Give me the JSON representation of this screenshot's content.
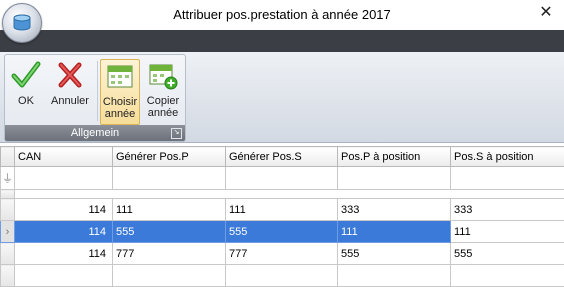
{
  "window": {
    "title": "Attribuer pos.prestation à année 2017",
    "close_glyph": "✕"
  },
  "ribbon": {
    "group_label": "Allgemein",
    "buttons": {
      "ok": "OK",
      "annuler": "Annuler",
      "choisir": "Choisir année",
      "copier": "Copier année"
    },
    "icons": [
      "check-icon",
      "x-icon",
      "calendar-icon",
      "calendar-add-icon"
    ]
  },
  "grid": {
    "columns": [
      "CAN",
      "Générer Pos.P",
      "Générer Pos.S",
      "Pos.P à position",
      "Pos.S à position"
    ],
    "rows": [
      {
        "can": "114",
        "gen_p": "111",
        "gen_s": "111",
        "pos_p": "333",
        "pos_s": "333"
      },
      {
        "can": "114",
        "gen_p": "555",
        "gen_s": "555",
        "pos_p": "111",
        "pos_s": "111"
      },
      {
        "can": "114",
        "gen_p": "777",
        "gen_s": "777",
        "pos_p": "555",
        "pos_s": "555"
      }
    ],
    "selected_row_index": 1
  },
  "colors": {
    "selection": "#3b7ad9",
    "ribbon_tab_bar": "#3b3e44",
    "group_label_bg": "#6b707a"
  }
}
